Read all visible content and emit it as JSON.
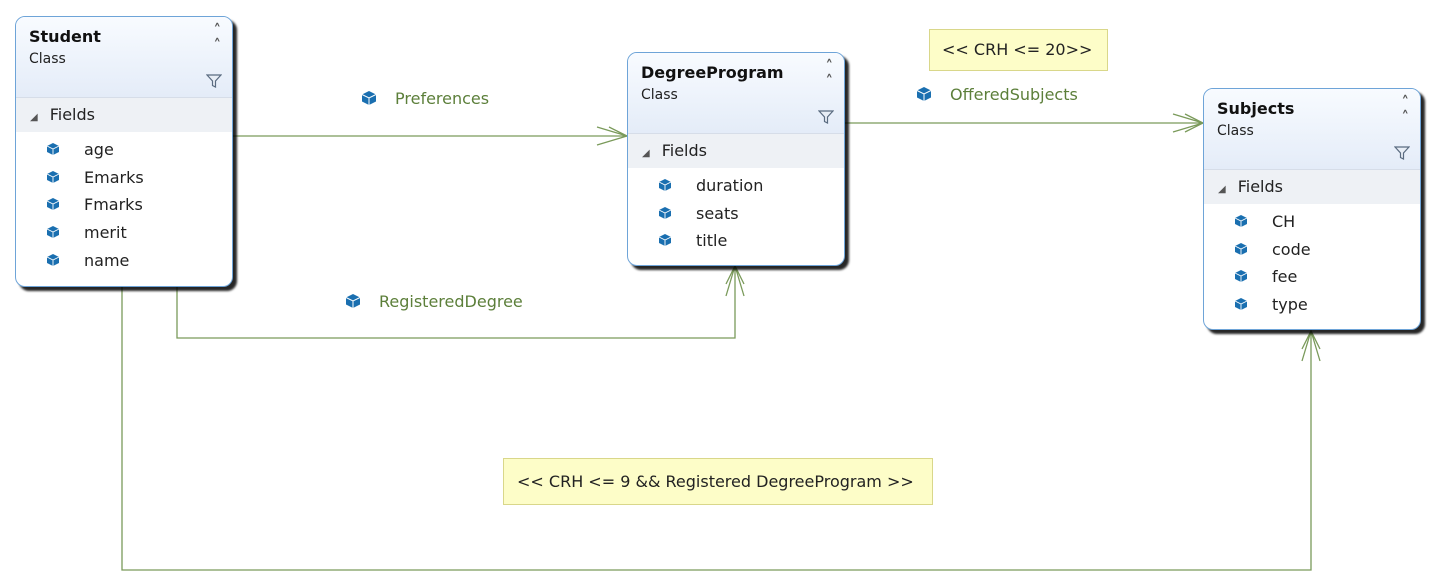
{
  "classes": {
    "student": {
      "name": "Student",
      "stereotype": "Class",
      "section": "Fields",
      "fields": [
        "age",
        "Emarks",
        "Fmarks",
        "merit",
        "name"
      ]
    },
    "degree_program": {
      "name": "DegreeProgram",
      "stereotype": "Class",
      "section": "Fields",
      "fields": [
        "duration",
        "seats",
        "title"
      ]
    },
    "subjects": {
      "name": "Subjects",
      "stereotype": "Class",
      "section": "Fields",
      "fields": [
        "CH",
        "code",
        "fee",
        "type"
      ]
    }
  },
  "associations": {
    "preferences": "Preferences",
    "registered_degree": "RegisteredDegree",
    "offered_subjects": "OfferedSubjects"
  },
  "notes": {
    "crh_20": "<< CRH <= 20>>",
    "crh_9": "<< CRH <= 9 && Registered DegreeProgram >>"
  },
  "icons": {
    "field": "field-cube-icon",
    "property": "property-cube-icon",
    "collapse": "double-chevron-up-icon",
    "filter": "filter-funnel-icon",
    "expand": "triangle-down-icon"
  },
  "colors": {
    "class_border": "#6ea4d8",
    "connector": "#7a9a5a",
    "association_label": "#5c7f3a",
    "note_fill": "#fdfdc8",
    "field_icon": "#1a6fb0"
  }
}
